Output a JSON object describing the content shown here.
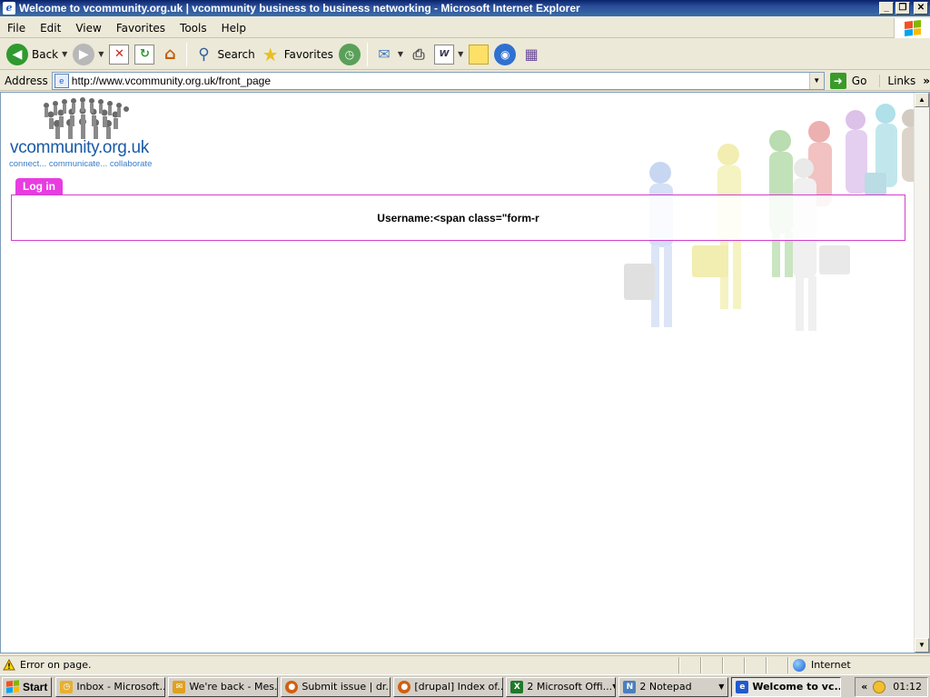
{
  "window": {
    "title": "Welcome to vcommunity.org.uk | vcommunity business to business networking - Microsoft Internet Explorer",
    "min": "_",
    "max": "❐",
    "close": "✕"
  },
  "menu": [
    "File",
    "Edit",
    "View",
    "Favorites",
    "Tools",
    "Help"
  ],
  "toolbar": {
    "back": "Back",
    "search": "Search",
    "favorites": "Favorites"
  },
  "address": {
    "label": "Address",
    "url": "http://www.vcommunity.org.uk/front_page",
    "go": "Go",
    "links": "Links"
  },
  "page": {
    "logo_text": "vcommunity.org.uk",
    "logo_tagline": "connect... communicate... collaborate",
    "login_tab": "Log in",
    "login_text": "Username:<span class=\"form-r"
  },
  "status": {
    "message": "Error on page.",
    "zone": "Internet"
  },
  "taskbar": {
    "start": "Start",
    "tasks": [
      {
        "label": "Inbox - Microsoft...",
        "icon_color": "#e8b030"
      },
      {
        "label": "We're back - Mes...",
        "icon_color": "#e0a020"
      },
      {
        "label": "Submit issue | dr...",
        "icon_color": "#d06010"
      },
      {
        "label": "[drupal] Index of...",
        "icon_color": "#d06010"
      },
      {
        "label": "2 Microsoft Offi...",
        "icon_color": "#1f7a2a"
      },
      {
        "label": "2 Notepad",
        "icon_color": "#4a7fc0"
      },
      {
        "label": "Welcome to vc...",
        "icon_color": "#1e5bd0"
      }
    ],
    "clock": "01:12"
  },
  "colors": {
    "accent_pink": "#e83ce0",
    "logo_blue": "#1a5aa8"
  }
}
